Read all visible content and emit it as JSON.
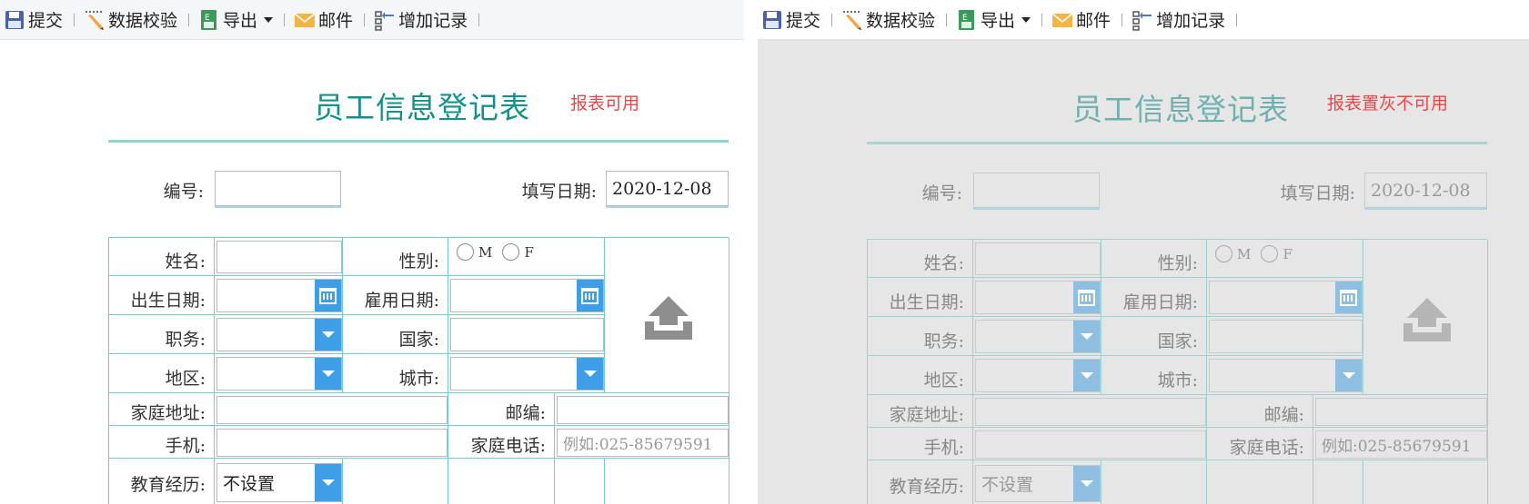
{
  "toolbar": {
    "submit": "提交",
    "validate": "数据校验",
    "export": "导出",
    "mail": "邮件",
    "add_record": "增加记录"
  },
  "form": {
    "title": "员工信息登记表",
    "id_label": "编号:",
    "fill_date_label": "填写日期:",
    "fill_date_value": "2020-12-08",
    "name_label": "姓名:",
    "gender_label": "性别:",
    "gender_m": "M",
    "gender_f": "F",
    "birth_label": "出生日期:",
    "hire_label": "雇用日期:",
    "job_label": "职务:",
    "country_label": "国家:",
    "region_label": "地区:",
    "city_label": "城市:",
    "address_label": "家庭地址:",
    "zip_label": "邮编:",
    "mobile_label": "手机:",
    "home_phone_label": "家庭电话:",
    "home_phone_placeholder": "例如:025-85679591",
    "education_label": "教育经历:",
    "education_value": "不设置"
  },
  "panels": {
    "left_note": "报表可用",
    "right_note": "报表置灰不可用"
  },
  "colors": {
    "accent": "#12918d",
    "note": "#f04343",
    "button": "#3e9ee8",
    "grid": "#6fd0cb"
  },
  "icons": [
    "save-icon",
    "pencil-icon",
    "excel-icon",
    "mail-icon",
    "add-record-icon",
    "calendar-icon",
    "chevron-down-icon",
    "upload-icon"
  ]
}
